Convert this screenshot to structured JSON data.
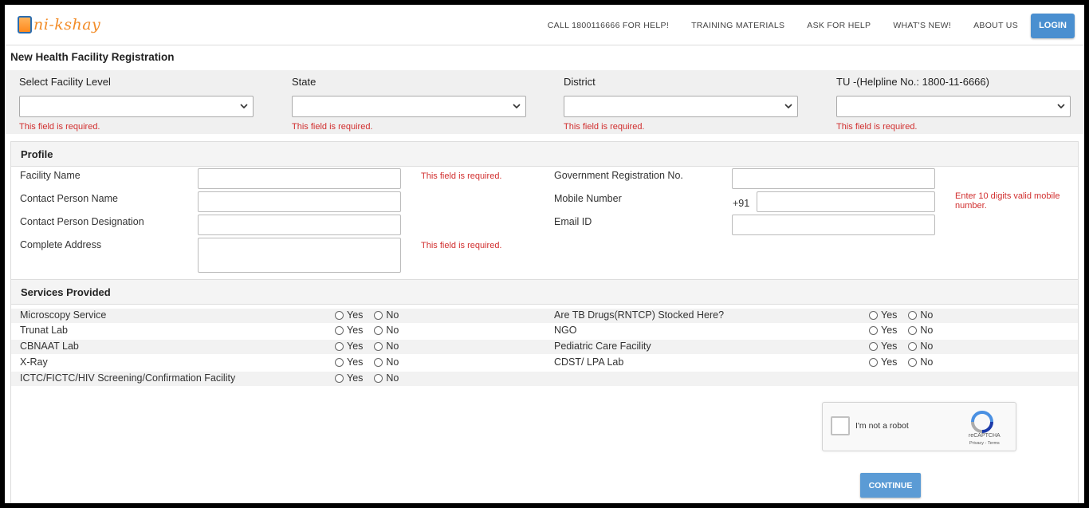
{
  "header": {
    "logo_text": "ni-kshay",
    "nav": [
      "CALL 1800116666 FOR HELP!",
      "TRAINING MATERIALS",
      "ASK FOR HELP",
      "WHAT'S NEW!",
      "ABOUT US"
    ],
    "login_label": "LOGIN"
  },
  "page_title": "New Health Facility Registration",
  "location": {
    "fields": [
      {
        "label": "Select Facility Level",
        "value": "",
        "error": "This field is required."
      },
      {
        "label": "State",
        "value": "",
        "error": "This field is required."
      },
      {
        "label": "District",
        "value": "",
        "error": "This field is required."
      },
      {
        "label": "TU -(Helpline No.: 1800-11-6666)",
        "value": "",
        "error": "This field is required."
      }
    ]
  },
  "profile": {
    "heading": "Profile",
    "facility_name": {
      "label": "Facility Name",
      "value": "",
      "error": "This field is required."
    },
    "contact_name": {
      "label": "Contact Person Name",
      "value": ""
    },
    "contact_designation": {
      "label": "Contact Person Designation",
      "value": ""
    },
    "address": {
      "label": "Complete Address",
      "value": "",
      "error": "This field is required."
    },
    "gov_reg": {
      "label": "Government Registration No.",
      "value": ""
    },
    "mobile": {
      "label": "Mobile Number",
      "prefix": "+91",
      "value": "",
      "error": "Enter 10 digits valid mobile number."
    },
    "email": {
      "label": "Email ID",
      "value": ""
    }
  },
  "services": {
    "heading": "Services Provided",
    "yes_label": "Yes",
    "no_label": "No",
    "left": [
      "Microscopy Service",
      "Trunat Lab",
      "CBNAAT Lab",
      "X-Ray",
      "ICTC/FICTC/HIV Screening/Confirmation Facility"
    ],
    "right": [
      "Are TB Drugs(RNTCP) Stocked Here?",
      "NGO",
      "Pediatric Care Facility",
      "CDST/ LPA Lab"
    ]
  },
  "captcha": {
    "label": "I'm not a robot",
    "brand": "reCAPTCHA",
    "terms": "Privacy - Terms"
  },
  "continue_label": "CONTINUE",
  "colors": {
    "accent": "#4a8fd0",
    "error": "#d12f2f",
    "logo": "#f28c28"
  }
}
